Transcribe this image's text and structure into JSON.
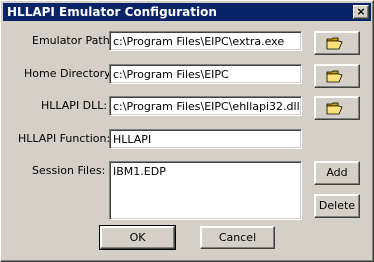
{
  "window": {
    "title": "HLLAPI Emulator Configuration",
    "close_icon": "×"
  },
  "fields": {
    "emulator_path": {
      "label": "Emulator Path:",
      "value": "c:\\Program Files\\EIPC\\extra.exe"
    },
    "home_directory": {
      "label": "Home Directory:",
      "value": "c:\\Program Files\\EIPC"
    },
    "hllapi_dll": {
      "label": "HLLAPI DLL:",
      "value": "c:\\Program Files\\EIPC\\ehllapi32.dll"
    },
    "hllapi_function": {
      "label": "HLLAPI Function:",
      "value": "HLLAPI"
    }
  },
  "session_files": {
    "label": "Session Files:",
    "items": [
      "IBM1.EDP"
    ]
  },
  "buttons": {
    "add": "Add",
    "delete": "Delete",
    "ok": "OK",
    "cancel": "Cancel"
  },
  "icons": {
    "browse": "folder-open-icon"
  }
}
